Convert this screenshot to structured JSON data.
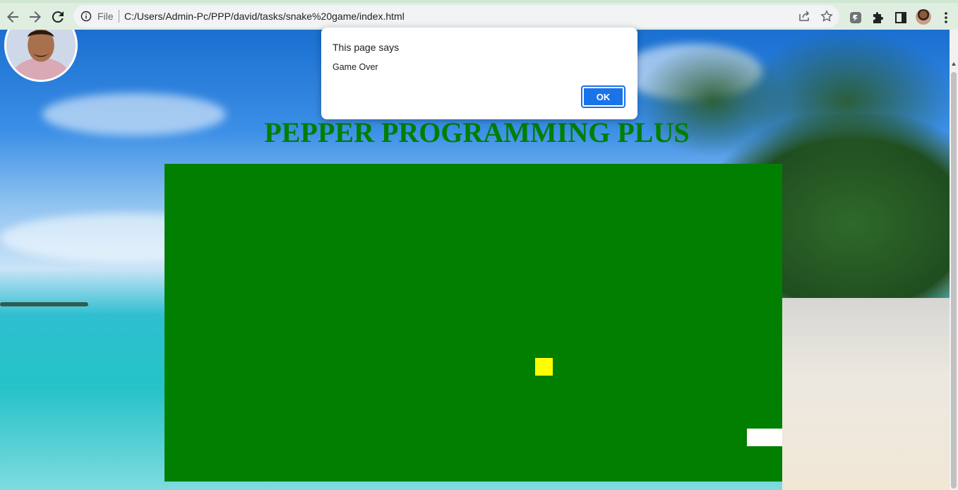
{
  "browser": {
    "scheme_label": "File",
    "url": "C:/Users/Admin-Pc/PPP/david/tasks/snake%20game/index.html"
  },
  "page": {
    "title": "PEPPER PROGRAMMING PLUS"
  },
  "game": {
    "board_color": "#007f00",
    "food_color": "#ffff00",
    "snake_color": "#ffffff",
    "state": "game-over"
  },
  "dialog": {
    "title": "This page says",
    "message": "Game Over",
    "ok_label": "OK"
  },
  "colors": {
    "title": "#007f00",
    "ok_button": "#1a73e8"
  }
}
